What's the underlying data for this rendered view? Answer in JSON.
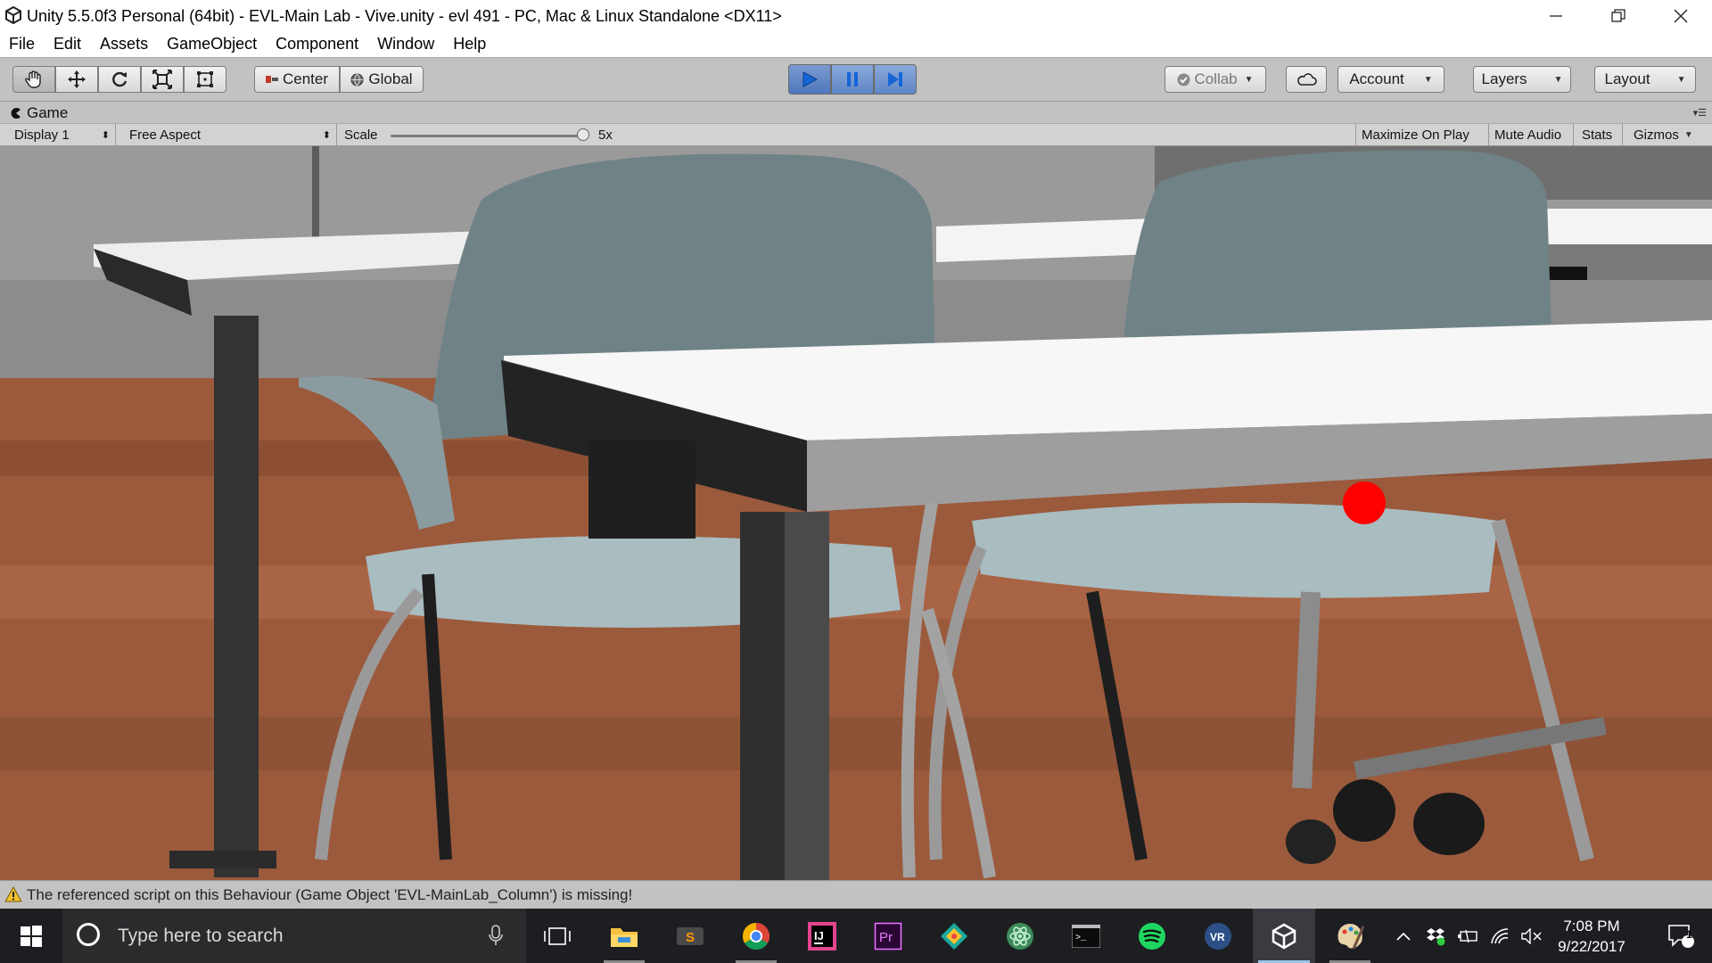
{
  "window": {
    "title": "Unity 5.5.0f3 Personal (64bit) - EVL-Main Lab - Vive.unity - evl 491 - PC, Mac & Linux Standalone <DX11>",
    "controls": [
      "minimize-icon",
      "maximize-icon",
      "close-icon"
    ]
  },
  "menu": {
    "items": [
      "File",
      "Edit",
      "Assets",
      "GameObject",
      "Component",
      "Window",
      "Help"
    ]
  },
  "toolbar": {
    "tools": [
      "hand-icon",
      "move-icon",
      "rotate-icon",
      "scale-icon",
      "rect-tool-icon"
    ],
    "pivot_mode": "Center",
    "pivot_rotation": "Global",
    "play_state": "playing",
    "collab_label": "Collab",
    "account_label": "Account",
    "layers_label": "Layers",
    "layout_label": "Layout",
    "accent_color": "#3d6fd1"
  },
  "game_view": {
    "tab_label": "Game",
    "display": "Display 1",
    "aspect": "Free Aspect",
    "scale_label": "Scale",
    "scale_value_label": "5x",
    "scale_value": 5,
    "options": [
      "Maximize On Play",
      "Mute Audio",
      "Stats",
      "Gizmos"
    ],
    "reticle_color": "#ff0000"
  },
  "status": {
    "icon": "warning-icon",
    "message": "The referenced script on this Behaviour (Game Object 'EVL-MainLab_Column') is missing!"
  },
  "taskbar": {
    "search_placeholder": "Type here to search",
    "apps": [
      "task-view",
      "file-explorer",
      "sublime-text",
      "chrome",
      "intellij",
      "premiere-pro",
      "git-kraken",
      "atom",
      "terminal",
      "spotify",
      "vr-app",
      "unity",
      "paint"
    ],
    "time": "7:08 PM",
    "date": "9/22/2017",
    "notification_count": "1"
  }
}
